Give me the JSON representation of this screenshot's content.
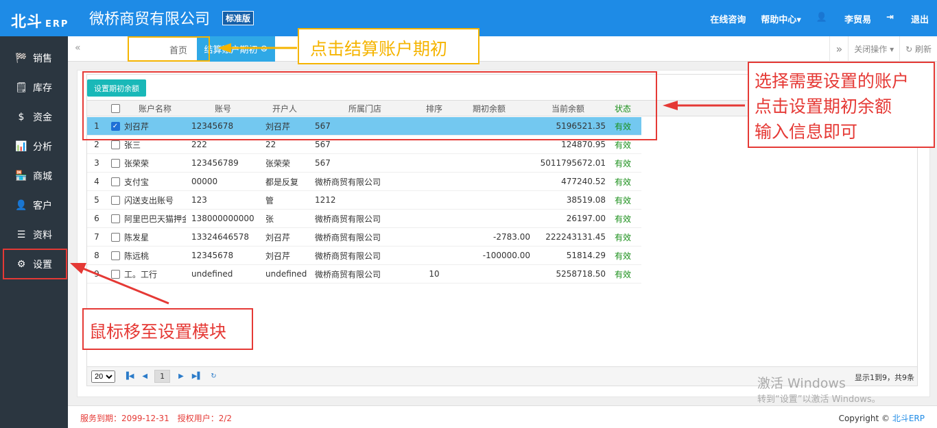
{
  "header": {
    "logo": "北斗",
    "logo_sub": "ERP",
    "company": "微桥商贸有限公司",
    "edition": "标准版",
    "nav": [
      {
        "icon": "",
        "label": "在线咨询"
      },
      {
        "icon": "",
        "label": "帮助中心▾"
      },
      {
        "icon": "👤",
        "label": "李贸易"
      },
      {
        "icon": "⇥",
        "label": "退出"
      }
    ]
  },
  "sidebar": {
    "items": [
      {
        "icon": "🏁",
        "label": "销售"
      },
      {
        "icon": "🗒",
        "label": "库存"
      },
      {
        "icon": "$",
        "label": "资金"
      },
      {
        "icon": "📊",
        "label": "分析"
      },
      {
        "icon": "🏪",
        "label": "商城"
      },
      {
        "icon": "👤",
        "label": "客户"
      },
      {
        "icon": "☰",
        "label": "资料"
      },
      {
        "icon": "⚙",
        "label": "设置"
      }
    ]
  },
  "tabs": {
    "prev": "«",
    "home": "首页",
    "active": "结算账户期初",
    "close": "⊗",
    "next": "»",
    "close_ops": "关闭操作 ▾",
    "refresh": "↻ 刷新"
  },
  "grid": {
    "set_button": "设置期初余额",
    "columns": [
      "账户名称",
      "账号",
      "开户人",
      "所属门店",
      "排序",
      "期初余额",
      "当前余额",
      "状态"
    ],
    "rows": [
      {
        "n": "1",
        "name": "刘召芹",
        "acct": "12345678",
        "holder": "刘召芹",
        "store": "567",
        "sort": "",
        "init": "",
        "cur": "5196521.35",
        "status": "有效",
        "checked": true
      },
      {
        "n": "2",
        "name": "张三",
        "acct": "222",
        "holder": "22",
        "store": "567",
        "sort": "",
        "init": "",
        "cur": "124870.95",
        "status": "有效",
        "checked": false
      },
      {
        "n": "3",
        "name": "张荣荣",
        "acct": "123456789",
        "holder": "张荣荣",
        "store": "567",
        "sort": "",
        "init": "",
        "cur": "5011795672.01",
        "status": "有效",
        "checked": false
      },
      {
        "n": "4",
        "name": "支付宝",
        "acct": "00000",
        "holder": "都是反复",
        "store": "微桥商贸有限公司",
        "sort": "",
        "init": "",
        "cur": "477240.52",
        "status": "有效",
        "checked": false
      },
      {
        "n": "5",
        "name": "闪送支出账号",
        "acct": "123",
        "holder": "管",
        "store": "1212",
        "sort": "",
        "init": "",
        "cur": "38519.08",
        "status": "有效",
        "checked": false
      },
      {
        "n": "6",
        "name": "阿里巴巴天猫押金",
        "acct": "138000000000",
        "holder": "张",
        "store": "微桥商贸有限公司",
        "sort": "",
        "init": "",
        "cur": "26197.00",
        "status": "有效",
        "checked": false
      },
      {
        "n": "7",
        "name": "陈发星",
        "acct": "13324646578",
        "holder": "刘召芹",
        "store": "微桥商贸有限公司",
        "sort": "",
        "init": "-2783.00",
        "cur": "222243131.45",
        "status": "有效",
        "checked": false
      },
      {
        "n": "8",
        "name": "陈远桃",
        "acct": "12345678",
        "holder": "刘召芹",
        "store": "微桥商贸有限公司",
        "sort": "",
        "init": "-100000.00",
        "cur": "51814.29",
        "status": "有效",
        "checked": false
      },
      {
        "n": "9",
        "name": "工。工行",
        "acct": "undefined",
        "holder": "undefined",
        "store": "微桥商贸有限公司",
        "sort": "10",
        "init": "",
        "cur": "5258718.50",
        "status": "有效",
        "checked": false
      }
    ]
  },
  "pager": {
    "page_size": "20",
    "page": "1",
    "info": "显示1到9，共9条"
  },
  "footer": {
    "left": "服务到期：2099-12-31　授权用户：2/2",
    "right_prefix": "Copyright © ",
    "right_brand": "北斗ERP"
  },
  "watermark": {
    "line1": "激活 Windows",
    "line2": "转到“设置”以激活 Windows。"
  },
  "annotations": {
    "tab": "点击结算账户期初",
    "settings": "鼠标移至设置模块",
    "grid": [
      "选择需要设置的账户",
      "点击设置期初余额",
      "输入信息即可"
    ]
  },
  "colors": {
    "header": "#1e8be6",
    "sidebar": "#2b3640",
    "accent": "#2fa8e6",
    "annotation": "#e53935",
    "highlight": "#f5b400"
  }
}
